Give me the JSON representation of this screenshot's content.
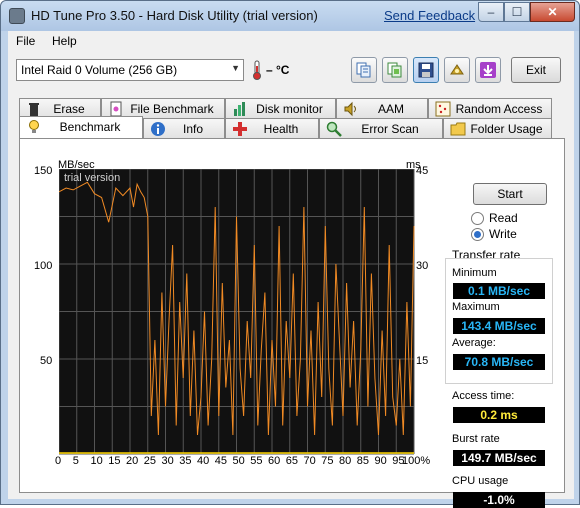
{
  "window": {
    "title": "HD Tune Pro 3.50 - Hard Disk Utility (trial version)",
    "feedback_link": "Send Feedback",
    "min_glyph": "–",
    "max_glyph": "☐",
    "close_glyph": "✕"
  },
  "menu": {
    "file": "File",
    "help": "Help"
  },
  "toolbar": {
    "drive": "Intel   Raid 0 Volume (256 GB)",
    "temperature": "– °C",
    "exit_label": "Exit",
    "icons": [
      "copy-icon",
      "copy-screenshot-icon",
      "save-icon",
      "options-icon",
      "download-icon"
    ]
  },
  "tabs_row1": [
    "Erase",
    "File Benchmark",
    "Disk monitor",
    "AAM",
    "Random Access"
  ],
  "tabs_row2": [
    "Benchmark",
    "Info",
    "Health",
    "Error Scan",
    "Folder Usage"
  ],
  "active_tab": "Benchmark",
  "chart_data": {
    "type": "line",
    "title": "trial version",
    "ylabel_left": "MB/sec",
    "ylabel_right": "ms",
    "left_ticks": [
      "150",
      "100",
      "50"
    ],
    "right_ticks": [
      "45",
      "30",
      "15"
    ],
    "x_ticks": [
      "0",
      "5",
      "10",
      "15",
      "20",
      "25",
      "30",
      "35",
      "40",
      "45",
      "50",
      "55",
      "60",
      "65",
      "70",
      "75",
      "80",
      "85",
      "90",
      "95",
      "100%"
    ],
    "ylim_left": [
      0,
      150
    ],
    "ylim_right": [
      0,
      45
    ],
    "xlim": [
      0,
      100
    ],
    "background": "#111111",
    "grid_color": "#555555",
    "series": [
      {
        "color": "#f08a24",
        "x": [
          0,
          2,
          4,
          6,
          8,
          10,
          12,
          14,
          16,
          18,
          20,
          21,
          22,
          23,
          24,
          24.5,
          25,
          26,
          27,
          28,
          29,
          30,
          31,
          32,
          33,
          34,
          35,
          36,
          37,
          38,
          39,
          40,
          41,
          42,
          43,
          44,
          45,
          46,
          47,
          48,
          49,
          50,
          51,
          52,
          53,
          54,
          55,
          56,
          57,
          58,
          59,
          60,
          61,
          62,
          63,
          64,
          65,
          66,
          67,
          68,
          69,
          70,
          71,
          72,
          73,
          74,
          75,
          76,
          77,
          78,
          79,
          80,
          81,
          82,
          83,
          84,
          85,
          86,
          87,
          88,
          89,
          90,
          91,
          92,
          93,
          94,
          95,
          96,
          97,
          98,
          99,
          100
        ],
        "y": [
          138,
          140,
          139,
          141,
          143,
          137,
          135,
          122,
          140,
          136,
          140,
          130,
          142,
          138,
          135,
          130,
          125,
          20,
          60,
          10,
          85,
          25,
          70,
          110,
          15,
          80,
          40,
          95,
          20,
          65,
          10,
          30,
          75,
          15,
          50,
          130,
          20,
          90,
          35,
          60,
          10,
          125,
          45,
          20,
          70,
          40,
          110,
          15,
          55,
          85,
          10,
          60,
          25,
          120,
          15,
          70,
          40,
          95,
          20,
          50,
          130,
          25,
          65,
          10,
          80,
          30,
          120,
          45,
          15,
          100,
          60,
          20,
          90,
          35,
          70,
          15,
          55,
          130,
          25,
          95,
          40,
          10,
          65,
          20,
          110,
          30,
          15,
          50,
          10,
          80,
          25,
          120
        ]
      }
    ]
  },
  "controls": {
    "start_label": "Start",
    "read_label": "Read",
    "write_label": "Write",
    "mode": "Write"
  },
  "results": {
    "group_title": "Transfer rate",
    "minimum_label": "Minimum",
    "minimum_value": "0.1 MB/sec",
    "maximum_label": "Maximum",
    "maximum_value": "143.4 MB/sec",
    "average_label": "Average:",
    "average_value": "70.8 MB/sec",
    "access_label": "Access time:",
    "access_value": "0.2 ms",
    "burst_label": "Burst rate",
    "burst_value": "149.7 MB/sec",
    "cpu_label": "CPU usage",
    "cpu_value": "-1.0%"
  }
}
